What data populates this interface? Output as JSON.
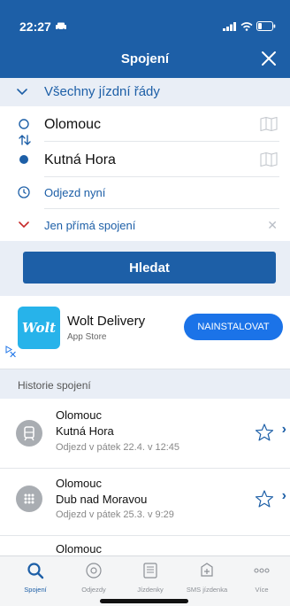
{
  "status": {
    "time": "22:27"
  },
  "nav": {
    "title": "Spojení"
  },
  "timetables": {
    "label": "Všechny jízdní řády"
  },
  "route": {
    "from": "Olomouc",
    "to": "Kutná Hora"
  },
  "options": {
    "departure": "Odjezd nyní",
    "direct_only": "Jen přímá spojení"
  },
  "search": {
    "label": "Hledat"
  },
  "ad": {
    "brand_logo": "Wolt",
    "name": "Wolt Delivery",
    "store": "App Store",
    "cta": "NAINSTALOVAT"
  },
  "history": {
    "title": "Historie spojení",
    "items": [
      {
        "from": "Olomouc",
        "to": "Kutná Hora",
        "when": "Odjezd v pátek 22.4. v 12:45",
        "icon": "train-icon"
      },
      {
        "from": "Olomouc",
        "to": "Dub nad Moravou",
        "when": "Odjezd v pátek 25.3. v 9:29",
        "icon": "grid-icon"
      },
      {
        "from": "Olomouc"
      }
    ]
  },
  "tabs": [
    {
      "label": "Spojení",
      "icon": "search-icon",
      "active": true
    },
    {
      "label": "Odjezdy",
      "icon": "departures-icon",
      "active": false
    },
    {
      "label": "Jízdenky",
      "icon": "ticket-icon",
      "active": false
    },
    {
      "label": "SMS jízdenka",
      "icon": "sms-ticket-icon",
      "active": false
    },
    {
      "label": "Více",
      "icon": "more-icon",
      "active": false
    }
  ],
  "colors": {
    "brand": "#1d5fa7",
    "accent_red": "#c62828",
    "ad_button": "#1b73e8",
    "wolt": "#27b3ea"
  }
}
